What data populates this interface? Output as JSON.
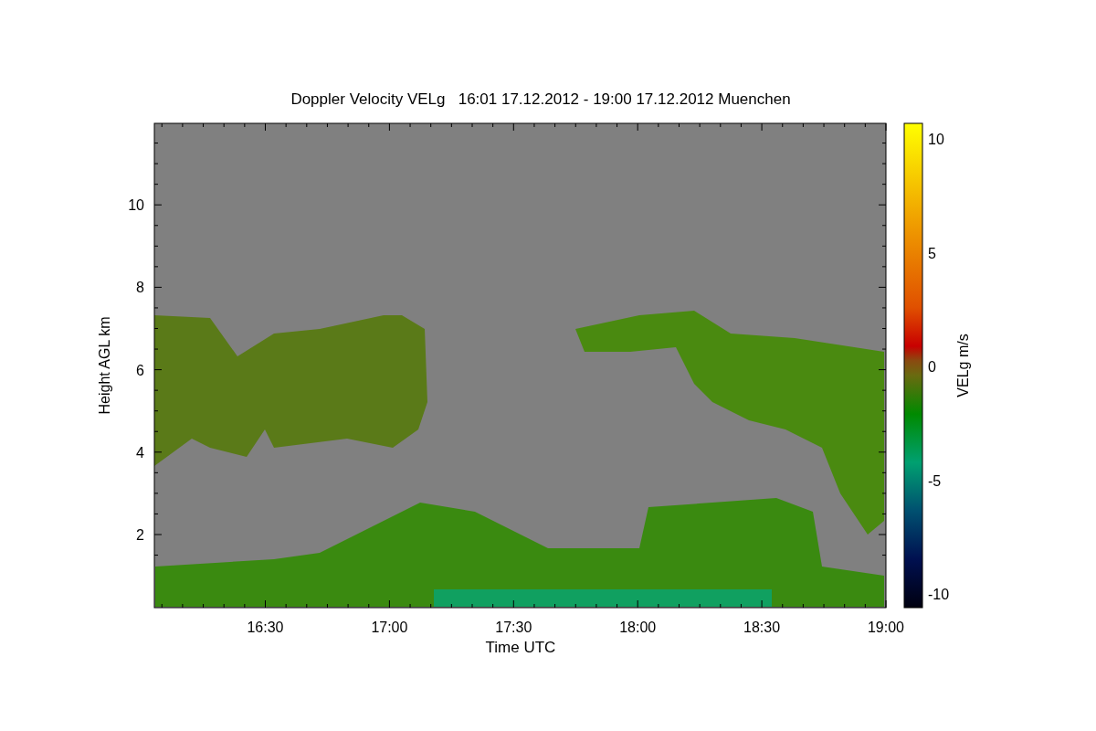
{
  "title": "Doppler Velocity VELg   16:01 17.12.2012 - 19:00 17.12.2012 Muenchen",
  "plot": {
    "x_axis": {
      "label": "Time UTC",
      "ticks": [
        "16:30",
        "17:00",
        "17:30",
        "18:00",
        "18:30",
        "19:00"
      ]
    },
    "y_axis": {
      "label": "Height AGL km",
      "ticks": [
        "10",
        "8",
        "6",
        "4",
        "2"
      ]
    }
  },
  "colorbar": {
    "label": "VELg m/s",
    "ticks": [
      "10",
      "5",
      "0",
      "-5",
      "-10"
    ]
  }
}
